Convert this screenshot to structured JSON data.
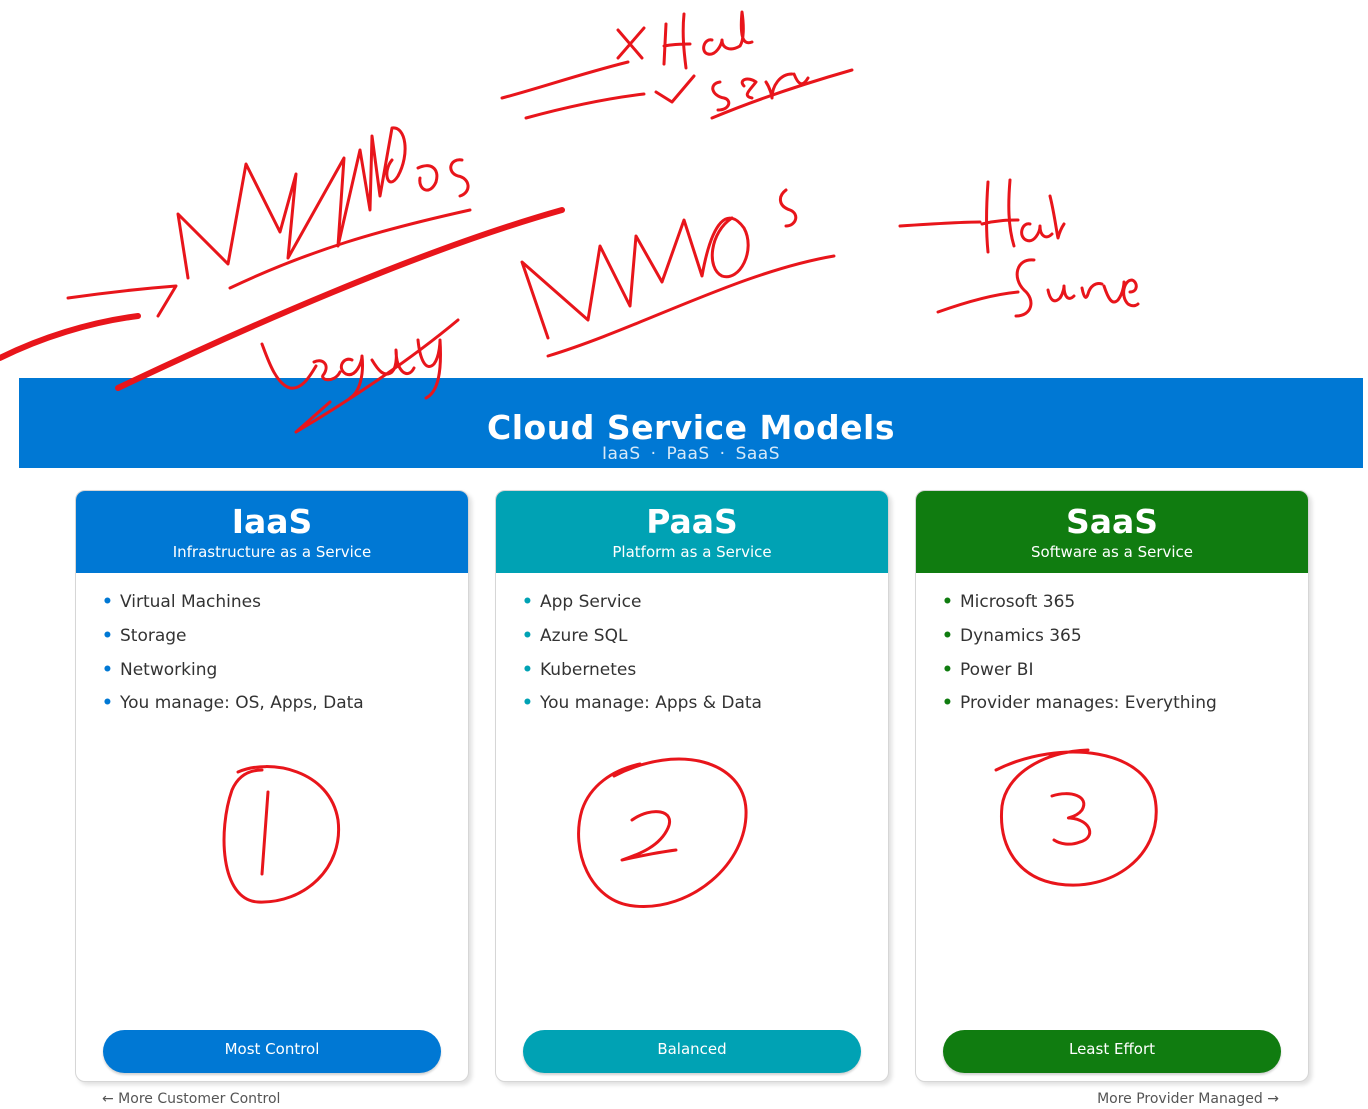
{
  "banner": {
    "title": "Cloud Service Models",
    "subtitle": [
      "IaaS",
      "PaaS",
      "SaaS"
    ],
    "separator": "·",
    "color": "#0078d4"
  },
  "cards": [
    {
      "name": "IaaS",
      "description": "Infrastructure as a Service",
      "color": "#0078d4",
      "items": [
        "Virtual Machines",
        "Storage",
        "Networking",
        "You manage: OS, Apps, Data"
      ],
      "badge": "Most Control",
      "badge_color": "#0078d4"
    },
    {
      "name": "PaaS",
      "description": "Platform as a Service",
      "color": "#00a2b4",
      "items": [
        "App Service",
        "Azure SQL",
        "Kubernetes",
        "You manage: Apps & Data"
      ],
      "badge": "Balanced",
      "badge_color": "#00a2b4"
    },
    {
      "name": "SaaS",
      "description": "Software as a Service",
      "color": "#107c10",
      "items": [
        "Microsoft 365",
        "Dynamics 365",
        "Power BI",
        "Provider manages: Everything"
      ],
      "badge": "Least Effort",
      "badge_color": "#107c10"
    }
  ],
  "footer": {
    "left": "← More Customer Control",
    "right": "More Provider Managed →"
  },
  "annotations": {
    "color": "#e8151b",
    "handwriting": [
      "MANOs",
      "MANOs",
      "Legacy",
      "X Hard",
      "✓ Serve",
      "Hard",
      "Serve",
      "1",
      "2",
      "3"
    ]
  }
}
